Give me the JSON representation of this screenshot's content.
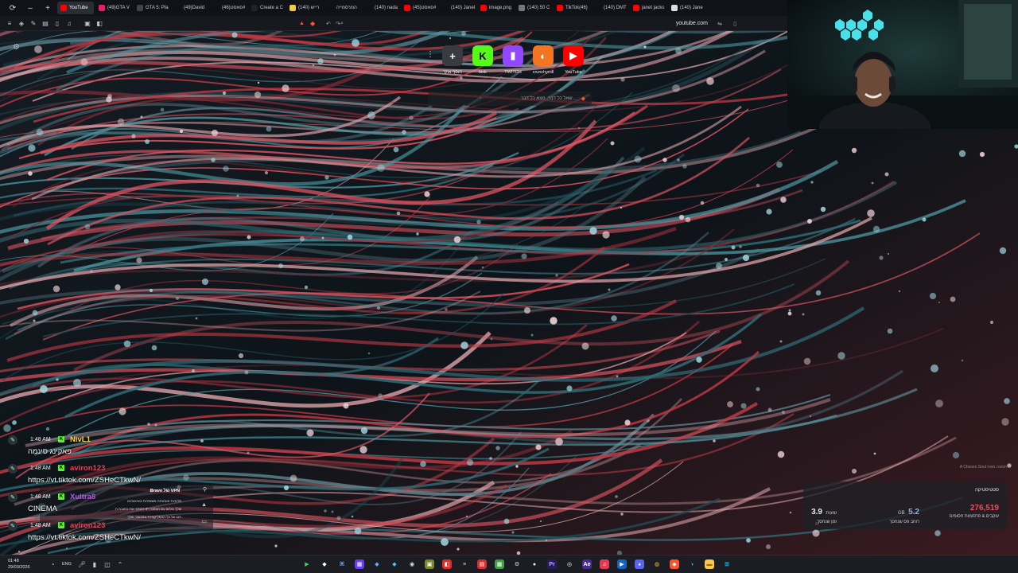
{
  "tabs": [
    {
      "label": "YouTube",
      "color": "#ff0000",
      "active": true
    },
    {
      "label": "(49)GTA V",
      "color": "#e91e63"
    },
    {
      "label": "GTA 5: Pla",
      "color": "#444444"
    },
    {
      "label": "(49)David",
      "color": "#111111"
    },
    {
      "label": "(46)פאסט#",
      "color": "#111111"
    },
    {
      "label": "Create a C",
      "color": "#222222"
    },
    {
      "label": "(140) רייש",
      "color": "#f2c94c"
    },
    {
      "label": "המרסמייה",
      "color": "#111111"
    },
    {
      "label": "(140) nada",
      "color": "#111111"
    },
    {
      "label": "(45)פאסט#",
      "color": "#ff0000"
    },
    {
      "label": "(140) Janet",
      "color": "#111111"
    },
    {
      "label": "image.png",
      "color": "#ff0000"
    },
    {
      "label": "(140) 50 C",
      "color": "#777777"
    },
    {
      "label": "TikTok(46)",
      "color": "#ff0000"
    },
    {
      "label": "(140) DMT",
      "color": "#111111"
    },
    {
      "label": "janet jacks",
      "color": "#ff0000"
    },
    {
      "label": "(140) Jane",
      "color": "#dddddd"
    }
  ],
  "toolbar": {
    "url": "youtube.com"
  },
  "shortcuts": [
    {
      "label": "הוסף אתר",
      "icon": "plus",
      "glyph": "+",
      "bg": "#3a3b40",
      "fg": "#ffffff"
    },
    {
      "label": "kick",
      "icon": "kick-logo",
      "glyph": "K",
      "bg": "#53fc18",
      "fg": "#000000"
    },
    {
      "label": "TWITCH",
      "icon": "twitch-logo",
      "glyph": "▮",
      "bg": "#9146ff",
      "fg": "#ffffff"
    },
    {
      "label": "crunchyroll",
      "icon": "crunchyroll-logo",
      "glyph": "◐",
      "bg": "#f47521",
      "fg": "#ffffff"
    },
    {
      "label": "YouTube",
      "icon": "youtube-logo",
      "glyph": "▶",
      "bg": "#ff0000",
      "fg": "#ffffff"
    }
  ],
  "search": {
    "placeholder": "שאל כל דבר, מצא כל דבר..."
  },
  "wallpaper_credit": "A Chosen Soul תמונה מאת",
  "stats": {
    "header": "סטטיסטיקה",
    "items": [
      {
        "value": "276,519",
        "unit": "",
        "caption": "עוקבים & פרסומות חסומים",
        "color": "#e8515a"
      },
      {
        "value": "5.2",
        "unit": "GB",
        "caption": "רוחב פס שנחסך",
        "color": "#8fb0d8"
      },
      {
        "value": "3.9",
        "unit": "שעות",
        "caption": "זמן שנחסך",
        "color": "#ffffff"
      }
    ]
  },
  "chat": [
    {
      "time": "1:48 AM",
      "user": "NivL1",
      "user_color": "#f3d23a",
      "text": "פאקינג סינמה"
    },
    {
      "time": "1:48 AM",
      "user": "aviron123",
      "user_color": "#e0445a",
      "text": "https://vt.tiktok.com/ZSHeCTkwN/"
    },
    {
      "time": "1:48 AM",
      "user": "Xultra8",
      "user_color": "#b35ad8",
      "text": "CINEMA"
    },
    {
      "time": "1:48 AM",
      "user": "aviron123",
      "user_color": "#e0445a",
      "text": "https://vt.tiktok.com/ZSHeCTkwN/"
    }
  ],
  "vpn": {
    "title": "Brave של VPN",
    "lines": [
      "פרטיות ואבטחה משופרות באינטרנט",
      "הסתר את כתובת ה-IP שלך וגלוש עם הצפנה",
      "הגנ על כל האפליקציות במכשיר שלך"
    ]
  },
  "taskbar": {
    "time": "01:48",
    "date": "29/03/2026",
    "lang": "ENG",
    "apps": [
      {
        "name": "play",
        "glyph": "▶",
        "bg": "#1b1d22",
        "fg": "#3fd85a"
      },
      {
        "name": "pin",
        "glyph": "◆",
        "bg": "#1b1d22",
        "fg": "#ffffff"
      },
      {
        "name": "code",
        "glyph": "⌘",
        "bg": "#1b1d22",
        "fg": "#6fa8ff"
      },
      {
        "name": "grid",
        "glyph": "▦",
        "bg": "#6b3df0",
        "fg": "#ffffff"
      },
      {
        "name": "diamond",
        "glyph": "◆",
        "bg": "#1b1d22",
        "fg": "#6fa8ff"
      },
      {
        "name": "diamond2",
        "glyph": "◆",
        "bg": "#1b1d22",
        "fg": "#4fc3f7"
      },
      {
        "name": "circle",
        "glyph": "◉",
        "bg": "#1b1d22",
        "fg": "#e0e0e0"
      },
      {
        "name": "box",
        "glyph": "▣",
        "bg": "#7a8a2a",
        "fg": "#ffffff"
      },
      {
        "name": "red-app",
        "glyph": "◧",
        "bg": "#e02b2b",
        "fg": "#ffffff"
      },
      {
        "name": "list",
        "glyph": "≡",
        "bg": "#1b1d22",
        "fg": "#ffd54f"
      },
      {
        "name": "pdf",
        "glyph": "▤",
        "bg": "#d32f2f",
        "fg": "#ffffff"
      },
      {
        "name": "apps",
        "glyph": "▦",
        "bg": "#43a047",
        "fg": "#ffffff"
      },
      {
        "name": "settings",
        "glyph": "⚙",
        "bg": "#1b1d22",
        "fg": "#dddddd"
      },
      {
        "name": "github",
        "glyph": "●",
        "bg": "#1b1d22",
        "fg": "#eeeeee"
      },
      {
        "name": "premiere",
        "glyph": "Pr",
        "bg": "#2a1a5e",
        "fg": "#b9a6ff"
      },
      {
        "name": "obs",
        "glyph": "◎",
        "bg": "#1b1d22",
        "fg": "#ffffff"
      },
      {
        "name": "aftereffects",
        "glyph": "Ae",
        "bg": "#4a2a8e",
        "fg": "#ffffff"
      },
      {
        "name": "music",
        "glyph": "♫",
        "bg": "#e53950",
        "fg": "#ffffff"
      },
      {
        "name": "media",
        "glyph": "▶",
        "bg": "#1565c0",
        "fg": "#ffffff"
      },
      {
        "name": "discord",
        "glyph": "◕",
        "bg": "#5865f2",
        "fg": "#ffffff"
      },
      {
        "name": "chrome",
        "glyph": "◍",
        "bg": "#1b1d22",
        "fg": "#fbc02d"
      },
      {
        "name": "brave",
        "glyph": "◆",
        "bg": "#fb542b",
        "fg": "#ffffff"
      },
      {
        "name": "edge",
        "glyph": "◑",
        "bg": "#1b1d22",
        "fg": "#29b6f6"
      },
      {
        "name": "folder",
        "glyph": "▬",
        "bg": "#f9c74f",
        "fg": "#8d6e00"
      },
      {
        "name": "windows",
        "glyph": "⊞",
        "bg": "#1b1d22",
        "fg": "#29b6f6"
      }
    ]
  }
}
